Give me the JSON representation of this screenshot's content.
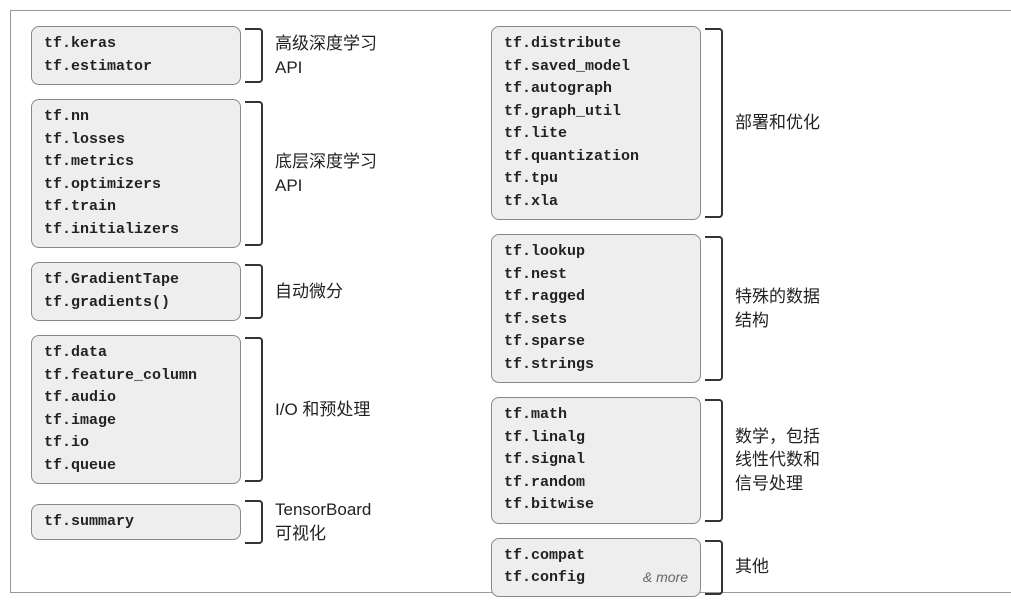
{
  "left": [
    {
      "items": [
        "tf.keras",
        "tf.estimator"
      ],
      "label": "高级深度学习\nAPI"
    },
    {
      "items": [
        "tf.nn",
        "tf.losses",
        "tf.metrics",
        "tf.optimizers",
        "tf.train",
        "tf.initializers"
      ],
      "label": "底层深度学习\nAPI"
    },
    {
      "items": [
        "tf.GradientTape",
        "tf.gradients()"
      ],
      "label": "自动微分"
    },
    {
      "items": [
        "tf.data",
        "tf.feature_column",
        "tf.audio",
        "tf.image",
        "tf.io",
        "tf.queue"
      ],
      "label": "I/O 和预处理"
    },
    {
      "items": [
        "tf.summary"
      ],
      "label": "TensorBoard\n可视化"
    }
  ],
  "right": [
    {
      "items": [
        "tf.distribute",
        "tf.saved_model",
        "tf.autograph",
        "tf.graph_util",
        "tf.lite",
        "tf.quantization",
        "tf.tpu",
        "tf.xla"
      ],
      "label": "部署和优化"
    },
    {
      "items": [
        "tf.lookup",
        "tf.nest",
        "tf.ragged",
        "tf.sets",
        "tf.sparse",
        "tf.strings"
      ],
      "label": "特殊的数据\n结构"
    },
    {
      "items": [
        "tf.math",
        "tf.linalg",
        "tf.signal",
        "tf.random",
        "tf.bitwise"
      ],
      "label": "数学，包括\n线性代数和\n信号处理"
    },
    {
      "items": [
        "tf.compat",
        "tf.config"
      ],
      "more": "& more",
      "label": "其他"
    }
  ]
}
